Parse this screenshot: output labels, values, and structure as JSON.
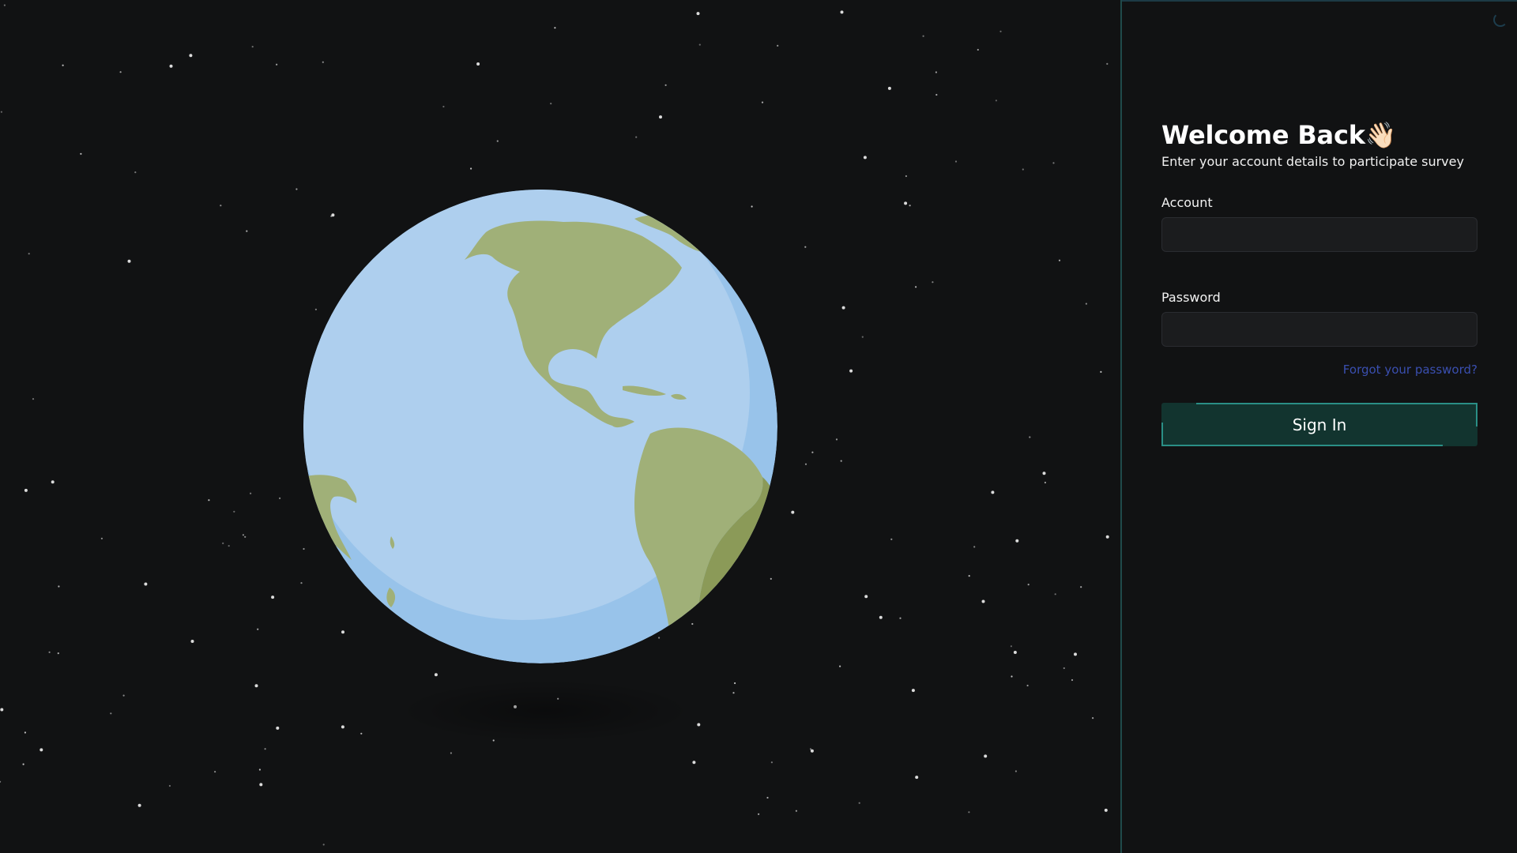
{
  "login": {
    "title": "Welcome Back",
    "wave_emoji": "👋🏻",
    "subtitle": "Enter your account details to participate survey",
    "account_label": "Account",
    "account_value": "",
    "password_label": "Password",
    "password_value": "",
    "forgot_label": "Forgot your password?",
    "signin_label": "Sign In"
  },
  "colors": {
    "background": "#111213",
    "ocean": "#aecfee",
    "ocean_shade": "#98c3ea",
    "land": "#a0b078",
    "land_shade": "#8b9a58",
    "accent": "#2a8f86",
    "button": "#12342f",
    "link": "#3a4fb0"
  },
  "icons": {
    "loading": "spinner-icon",
    "hero": "earth-globe-icon"
  }
}
